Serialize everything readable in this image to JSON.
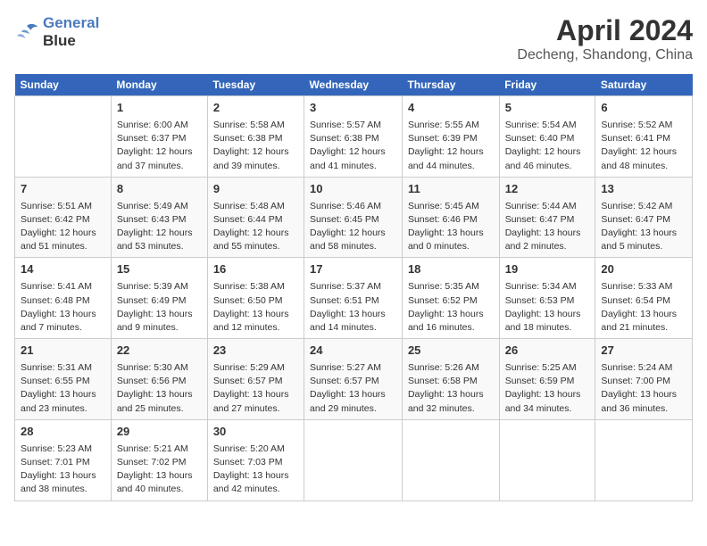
{
  "header": {
    "logo_line1": "General",
    "logo_line2": "Blue",
    "month_year": "April 2024",
    "location": "Decheng, Shandong, China"
  },
  "weekdays": [
    "Sunday",
    "Monday",
    "Tuesday",
    "Wednesday",
    "Thursday",
    "Friday",
    "Saturday"
  ],
  "weeks": [
    [
      {
        "day": "",
        "info": ""
      },
      {
        "day": "1",
        "info": "Sunrise: 6:00 AM\nSunset: 6:37 PM\nDaylight: 12 hours\nand 37 minutes."
      },
      {
        "day": "2",
        "info": "Sunrise: 5:58 AM\nSunset: 6:38 PM\nDaylight: 12 hours\nand 39 minutes."
      },
      {
        "day": "3",
        "info": "Sunrise: 5:57 AM\nSunset: 6:38 PM\nDaylight: 12 hours\nand 41 minutes."
      },
      {
        "day": "4",
        "info": "Sunrise: 5:55 AM\nSunset: 6:39 PM\nDaylight: 12 hours\nand 44 minutes."
      },
      {
        "day": "5",
        "info": "Sunrise: 5:54 AM\nSunset: 6:40 PM\nDaylight: 12 hours\nand 46 minutes."
      },
      {
        "day": "6",
        "info": "Sunrise: 5:52 AM\nSunset: 6:41 PM\nDaylight: 12 hours\nand 48 minutes."
      }
    ],
    [
      {
        "day": "7",
        "info": "Sunrise: 5:51 AM\nSunset: 6:42 PM\nDaylight: 12 hours\nand 51 minutes."
      },
      {
        "day": "8",
        "info": "Sunrise: 5:49 AM\nSunset: 6:43 PM\nDaylight: 12 hours\nand 53 minutes."
      },
      {
        "day": "9",
        "info": "Sunrise: 5:48 AM\nSunset: 6:44 PM\nDaylight: 12 hours\nand 55 minutes."
      },
      {
        "day": "10",
        "info": "Sunrise: 5:46 AM\nSunset: 6:45 PM\nDaylight: 12 hours\nand 58 minutes."
      },
      {
        "day": "11",
        "info": "Sunrise: 5:45 AM\nSunset: 6:46 PM\nDaylight: 13 hours\nand 0 minutes."
      },
      {
        "day": "12",
        "info": "Sunrise: 5:44 AM\nSunset: 6:47 PM\nDaylight: 13 hours\nand 2 minutes."
      },
      {
        "day": "13",
        "info": "Sunrise: 5:42 AM\nSunset: 6:47 PM\nDaylight: 13 hours\nand 5 minutes."
      }
    ],
    [
      {
        "day": "14",
        "info": "Sunrise: 5:41 AM\nSunset: 6:48 PM\nDaylight: 13 hours\nand 7 minutes."
      },
      {
        "day": "15",
        "info": "Sunrise: 5:39 AM\nSunset: 6:49 PM\nDaylight: 13 hours\nand 9 minutes."
      },
      {
        "day": "16",
        "info": "Sunrise: 5:38 AM\nSunset: 6:50 PM\nDaylight: 13 hours\nand 12 minutes."
      },
      {
        "day": "17",
        "info": "Sunrise: 5:37 AM\nSunset: 6:51 PM\nDaylight: 13 hours\nand 14 minutes."
      },
      {
        "day": "18",
        "info": "Sunrise: 5:35 AM\nSunset: 6:52 PM\nDaylight: 13 hours\nand 16 minutes."
      },
      {
        "day": "19",
        "info": "Sunrise: 5:34 AM\nSunset: 6:53 PM\nDaylight: 13 hours\nand 18 minutes."
      },
      {
        "day": "20",
        "info": "Sunrise: 5:33 AM\nSunset: 6:54 PM\nDaylight: 13 hours\nand 21 minutes."
      }
    ],
    [
      {
        "day": "21",
        "info": "Sunrise: 5:31 AM\nSunset: 6:55 PM\nDaylight: 13 hours\nand 23 minutes."
      },
      {
        "day": "22",
        "info": "Sunrise: 5:30 AM\nSunset: 6:56 PM\nDaylight: 13 hours\nand 25 minutes."
      },
      {
        "day": "23",
        "info": "Sunrise: 5:29 AM\nSunset: 6:57 PM\nDaylight: 13 hours\nand 27 minutes."
      },
      {
        "day": "24",
        "info": "Sunrise: 5:27 AM\nSunset: 6:57 PM\nDaylight: 13 hours\nand 29 minutes."
      },
      {
        "day": "25",
        "info": "Sunrise: 5:26 AM\nSunset: 6:58 PM\nDaylight: 13 hours\nand 32 minutes."
      },
      {
        "day": "26",
        "info": "Sunrise: 5:25 AM\nSunset: 6:59 PM\nDaylight: 13 hours\nand 34 minutes."
      },
      {
        "day": "27",
        "info": "Sunrise: 5:24 AM\nSunset: 7:00 PM\nDaylight: 13 hours\nand 36 minutes."
      }
    ],
    [
      {
        "day": "28",
        "info": "Sunrise: 5:23 AM\nSunset: 7:01 PM\nDaylight: 13 hours\nand 38 minutes."
      },
      {
        "day": "29",
        "info": "Sunrise: 5:21 AM\nSunset: 7:02 PM\nDaylight: 13 hours\nand 40 minutes."
      },
      {
        "day": "30",
        "info": "Sunrise: 5:20 AM\nSunset: 7:03 PM\nDaylight: 13 hours\nand 42 minutes."
      },
      {
        "day": "",
        "info": ""
      },
      {
        "day": "",
        "info": ""
      },
      {
        "day": "",
        "info": ""
      },
      {
        "day": "",
        "info": ""
      }
    ]
  ]
}
